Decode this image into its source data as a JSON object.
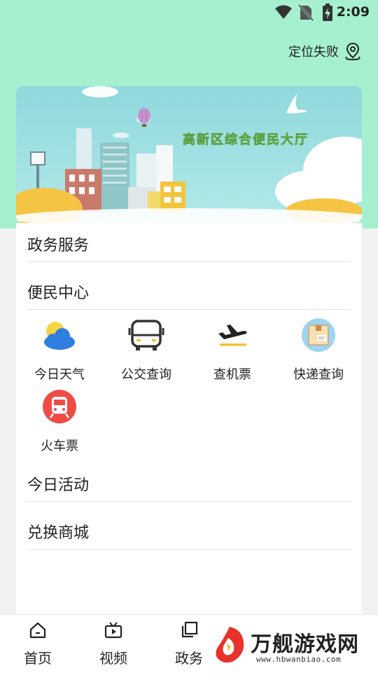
{
  "status_bar": {
    "time": "2:09"
  },
  "header": {
    "location_label": "定位失败"
  },
  "banner": {
    "title": "高新区综合便民大厅"
  },
  "sections": {
    "gov_services": "政务服务",
    "convenience_center": "便民中心",
    "today_activities": "今日活动",
    "exchange_mall": "兑换商城"
  },
  "services": [
    {
      "label": "今日天气",
      "icon": "weather-icon"
    },
    {
      "label": "公交查询",
      "icon": "bus-icon"
    },
    {
      "label": "查机票",
      "icon": "airplane-icon"
    },
    {
      "label": "快递查询",
      "icon": "package-icon"
    },
    {
      "label": "火车票",
      "icon": "train-icon"
    }
  ],
  "tabbar": {
    "items": [
      {
        "label": "首页",
        "icon": "home-icon"
      },
      {
        "label": "视频",
        "icon": "video-icon"
      },
      {
        "label": "政务",
        "icon": "gov-icon"
      }
    ]
  },
  "watermark": {
    "text": "万舰游戏网",
    "url": "www.hbwanbiao.com"
  },
  "colors": {
    "header_bg": "#a6f0d0",
    "page_bg": "#f2f2f2",
    "card_bg": "#ffffff",
    "train_red": "#ef4b45",
    "package_blue": "#9fd4f2"
  }
}
